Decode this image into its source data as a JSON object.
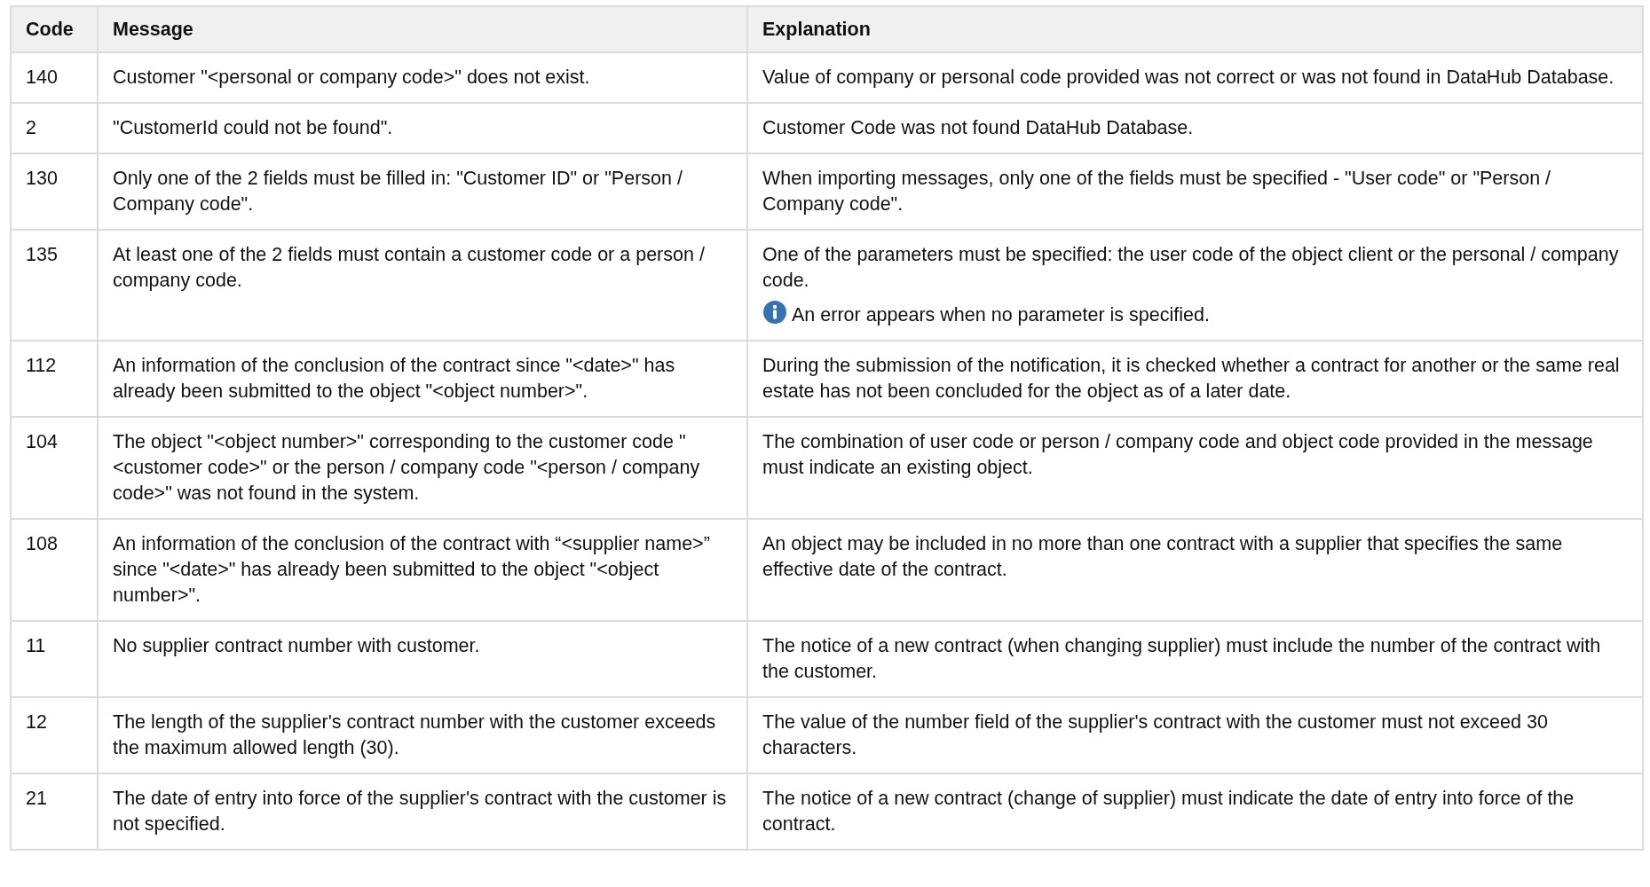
{
  "table": {
    "columns": [
      "Code",
      "Message",
      "Explanation"
    ],
    "rows": [
      {
        "code": "140",
        "message": "Customer \"<personal or company code>\" does not exist.",
        "explanation": "Value of company or personal code provided was not correct or was not found in DataHub Database."
      },
      {
        "code": "2",
        "message": "\"CustomerId could not be found\".",
        "explanation": "Customer Code was not found DataHub Database."
      },
      {
        "code": "130",
        "message": "Only one of the 2 fields must be filled in: \"Customer ID\" or \"Person / Company code\".",
        "explanation": "When importing messages, only one of the fields must be specified - \"User code\" or \"Person / Company code\"."
      },
      {
        "code": "135",
        "message": "At least one of the 2 fields must contain a customer code or a person / company code.",
        "explanation": "One of the parameters must be specified: the user code of the object client or the personal / company code.",
        "note": "An error appears when no parameter is specified."
      },
      {
        "code": "112",
        "message": "An information of the conclusion of the contract since \"<date>\" has already been submitted to the object \"<object number>\".",
        "explanation": "During the submission of the notification, it is checked whether a contract for another or the same real estate has not been concluded for the object as of a later date."
      },
      {
        "code": "104",
        "message": "The object \"<object number>\" corresponding to the customer code \"<customer code>\" or the person / company code \"<person / company code>\" was not found in the system.",
        "explanation": "The combination of user code or person / company code and object code provided in the message must indicate an existing object."
      },
      {
        "code": "108",
        "message": "An information of the conclusion of the contract with “<supplier name>” since \"<date>\" has already been submitted to the object \"<object number>\".",
        "explanation": "An object may be included in no more than one contract with a supplier that specifies the same effective date of the contract."
      },
      {
        "code": "11",
        "message": "No supplier contract number with customer.",
        "explanation": "The notice of a new contract (when changing supplier) must include the number of the contract with the customer."
      },
      {
        "code": "12",
        "message": "The length of the supplier's contract number with the customer exceeds the maximum allowed length (30).",
        "explanation": "The value of the number field of the supplier's contract with the customer must not exceed 30 characters."
      },
      {
        "code": "21",
        "message": "The date of entry into force of the supplier's contract with the customer is not specified.",
        "explanation": "The notice of a new contract (change of supplier) must indicate the date of entry into force of the contract."
      }
    ]
  }
}
